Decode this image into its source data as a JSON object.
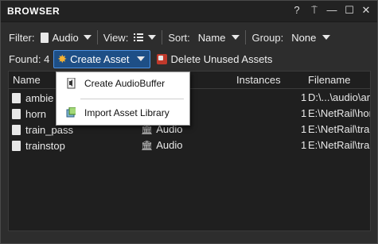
{
  "window": {
    "title": "BROWSER",
    "controls": {
      "help": "?",
      "pin": "⍑",
      "minimize": "—",
      "maximize": "☐",
      "close": "✕"
    }
  },
  "toolbar": {
    "filter_label": "Filter:",
    "filter_value": "Audio",
    "view_label": "View:",
    "sort_label": "Sort:",
    "sort_value": "Name",
    "group_label": "Group:",
    "group_value": "None",
    "found_label": "Found: 4",
    "create_label": "Create Asset",
    "delete_label": "Delete Unused Assets"
  },
  "table": {
    "headers": {
      "name": "Name",
      "instances": "Instances",
      "filename": "Filename"
    },
    "rows": [
      {
        "name": "ambie",
        "type": "",
        "instances": "1",
        "filename": "D:\\...\\audio\\am"
      },
      {
        "name": "horn",
        "type": "",
        "instances": "1",
        "filename": "E:\\NetRail\\horn"
      },
      {
        "name": "train_pass",
        "type": "Audio",
        "instances": "1",
        "filename": "E:\\NetRail\\trai"
      },
      {
        "name": "trainstop",
        "type": "Audio",
        "instances": "1",
        "filename": "E:\\NetRail\\trai"
      }
    ]
  },
  "menu": {
    "items": [
      {
        "label": "Create AudioBuffer",
        "icon": "audio-buffer-icon"
      },
      {
        "label": "Import Asset Library",
        "icon": "asset-library-icon"
      }
    ]
  },
  "colors": {
    "accent": "#4a90e2",
    "selected_bg": "#1e4f86",
    "panel": "#1f1f1f",
    "background": "#2d2d2d"
  }
}
